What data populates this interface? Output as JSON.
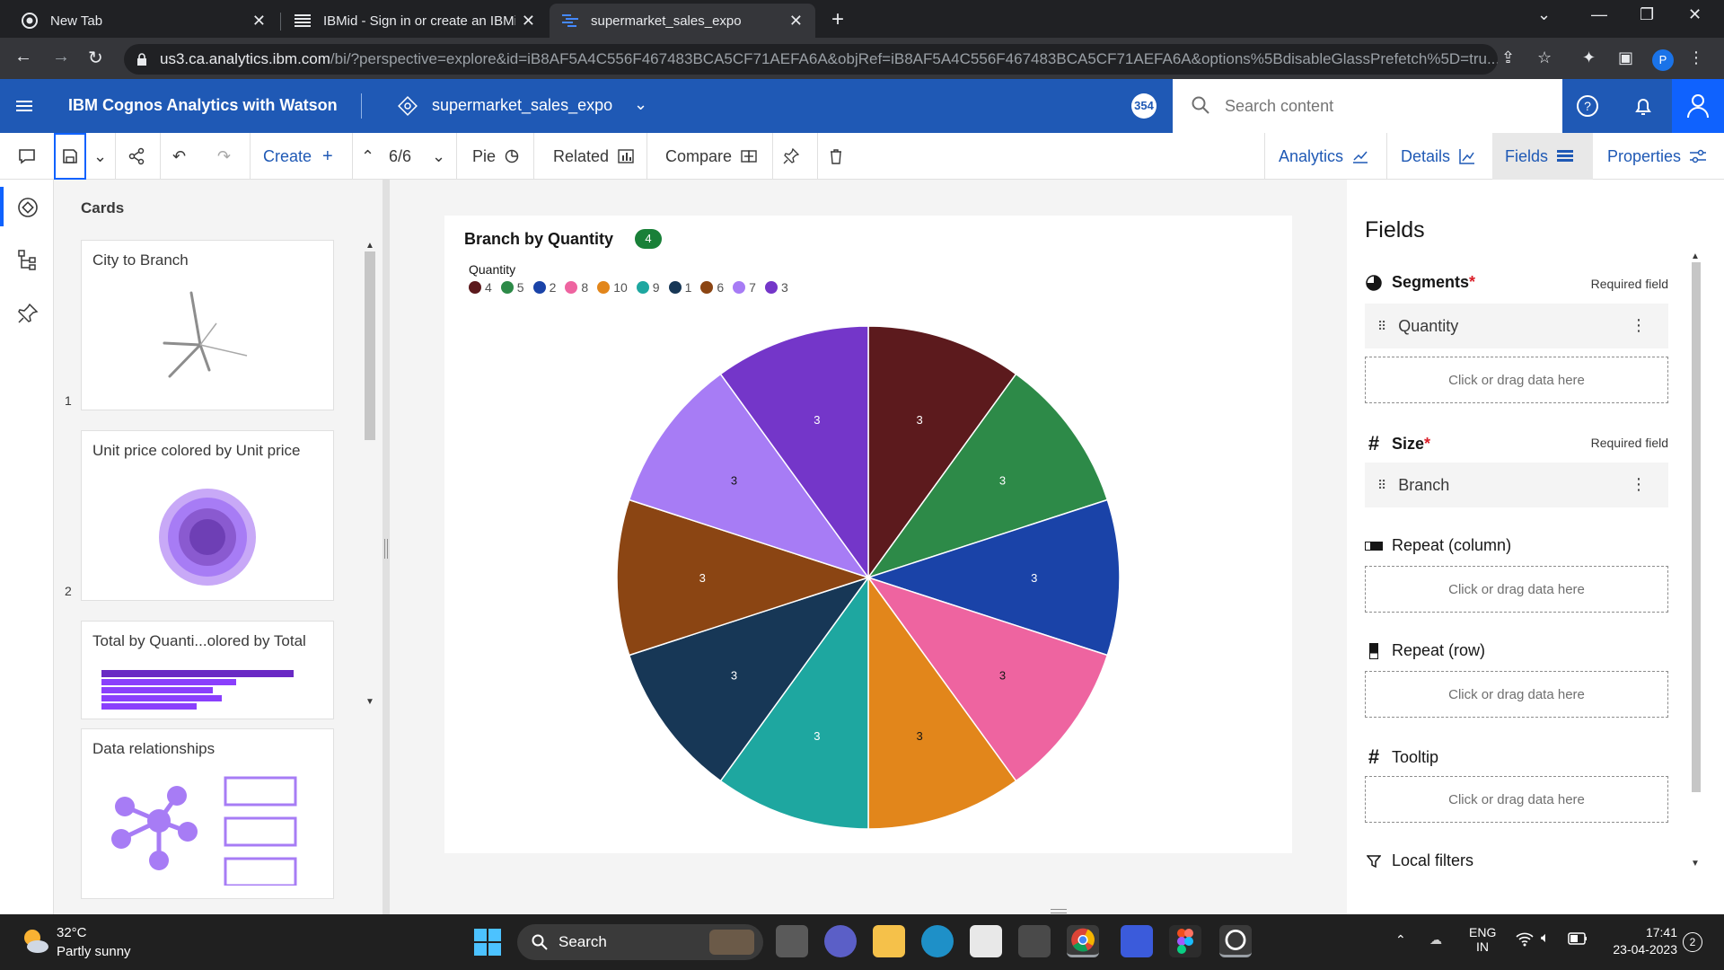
{
  "browser": {
    "tabs": [
      {
        "title": "New Tab"
      },
      {
        "title": "IBMid - Sign in or create an IBMid"
      },
      {
        "title": "supermarket_sales_expo"
      }
    ],
    "url_host": "us3.ca.analytics.ibm.com",
    "url_rest": "/bi/?perspective=explore&id=iB8AF5A4C556F467483BCA5CF71AEFA6A&objRef=iB8AF5A4C556F467483BCA5CF71AEFA6A&options%5BdisableGlassPrefetch%5D=tru...",
    "profile_initial": "P"
  },
  "app": {
    "title": "IBM Cognos Analytics with Watson",
    "datasource": "supermarket_sales_expo",
    "badge_count": "354",
    "search_placeholder": "Search content"
  },
  "toolbar": {
    "create_label": "Create",
    "page_indicator": "6/6",
    "viz_type": "Pie",
    "related_label": "Related",
    "compare_label": "Compare",
    "right_tabs": [
      "Analytics",
      "Details",
      "Fields",
      "Properties"
    ]
  },
  "cards_panel": {
    "title": "Cards",
    "cards": [
      {
        "title": "City to Branch",
        "number": "1"
      },
      {
        "title": "Unit price colored by Unit price",
        "number": "2"
      },
      {
        "title": "Total by Quanti...olored by Total",
        "number": ""
      },
      {
        "title": "Data relationships",
        "number": ""
      }
    ]
  },
  "chart": {
    "title": "Branch by Quantity",
    "badge": "4",
    "legend_title": "Quantity"
  },
  "chart_data": {
    "type": "pie",
    "title": "Branch by Quantity",
    "legend_title": "Quantity",
    "categories": [
      "4",
      "5",
      "2",
      "8",
      "10",
      "9",
      "1",
      "6",
      "7",
      "3"
    ],
    "values": [
      3,
      3,
      3,
      3,
      3,
      3,
      3,
      3,
      3,
      3
    ],
    "colors": [
      "#5c1a1d",
      "#2d8a48",
      "#1a43a8",
      "#ee64a0",
      "#e2861b",
      "#1ea7a0",
      "#173756",
      "#8b4513",
      "#a77cf5",
      "#7436c9"
    ],
    "legend_position": "top-left"
  },
  "fields_panel": {
    "title": "Fields",
    "required_text": "Required field",
    "drop_text": "Click or drag data here",
    "segments": {
      "label": "Segments",
      "value": "Quantity"
    },
    "size": {
      "label": "Size",
      "value": "Branch"
    },
    "repeat_column": "Repeat (column)",
    "repeat_row": "Repeat (row)",
    "tooltip": "Tooltip",
    "local_filters": "Local filters"
  },
  "taskbar": {
    "temp": "32°C",
    "condition": "Partly sunny",
    "search": "Search",
    "lang": "ENG",
    "region": "IN",
    "time": "17:41",
    "date": "23-04-2023",
    "notifications": "2"
  }
}
